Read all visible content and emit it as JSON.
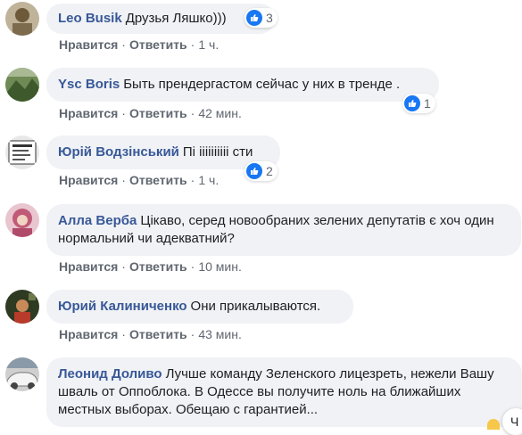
{
  "comments": [
    {
      "author": "Leo Busik",
      "text": "Друзья Ляшко)))",
      "like": "Нравится",
      "reply": "Ответить",
      "time": "1 ч.",
      "reactions": "3",
      "avatar_color": "#8a7a5c"
    },
    {
      "author": "Ysc Boris",
      "text": "Быть прендергастом сейчас у них в тренде .",
      "like": "Нравится",
      "reply": "Ответить",
      "time": "42 мин.",
      "reactions": "1",
      "avatar_color": "#4e6a3c"
    },
    {
      "author": "Юрій Водзінський",
      "text": "Пі іііііііііі сти",
      "like": "Нравится",
      "reply": "Ответить",
      "time": "1 ч.",
      "reactions": "2",
      "avatar_color": "#2b2b2b"
    },
    {
      "author": "Алла Верба",
      "text": "Цікаво, серед новообраних зелених депутатів є хоч один нормальний чи адекватний?",
      "like": "Нравится",
      "reply": "Ответить",
      "time": "10 мин.",
      "avatar_color": "#c05a78"
    },
    {
      "author": "Юрий Калиниченко",
      "text": "Они прикалываются.",
      "like": "Нравится",
      "reply": "Ответить",
      "time": "43 мин.",
      "avatar_color": "#3d4a2a"
    },
    {
      "author": "Леонид Доливо",
      "text": "Лучше команду Зеленского лицезреть, нежели Вашу шваль от Оппоблока. В Одессе вы получите ноль на ближайших местных выборах. Обещаю с гарантией...",
      "avatar_color": "#9a9a9a"
    }
  ],
  "corner_badge": "Ч",
  "like_icon": "thumbs-up-icon",
  "colors": {
    "author": "#385898",
    "bubble": "#f0f2f5",
    "meta": "#606770",
    "like_badge": "#1877f2"
  }
}
